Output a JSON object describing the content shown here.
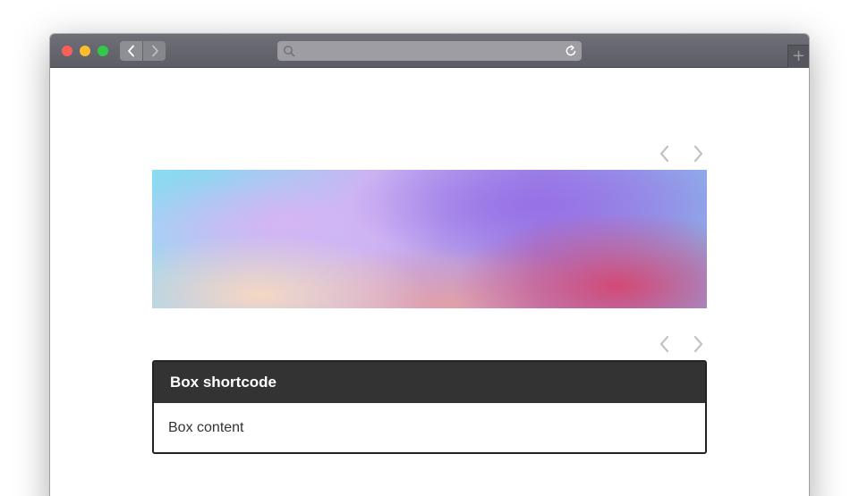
{
  "browser": {
    "traffic_lights": [
      "close",
      "minimize",
      "zoom"
    ],
    "colors": {
      "close": "#fc5f57",
      "minimize": "#fdbc2e",
      "zoom": "#34c84a",
      "titlebar": "#65656e"
    },
    "url_text": "",
    "new_tab_symbol": "+"
  },
  "page": {
    "box": {
      "title": "Box shortcode",
      "content": "Box content",
      "header_color": "#333333"
    }
  }
}
